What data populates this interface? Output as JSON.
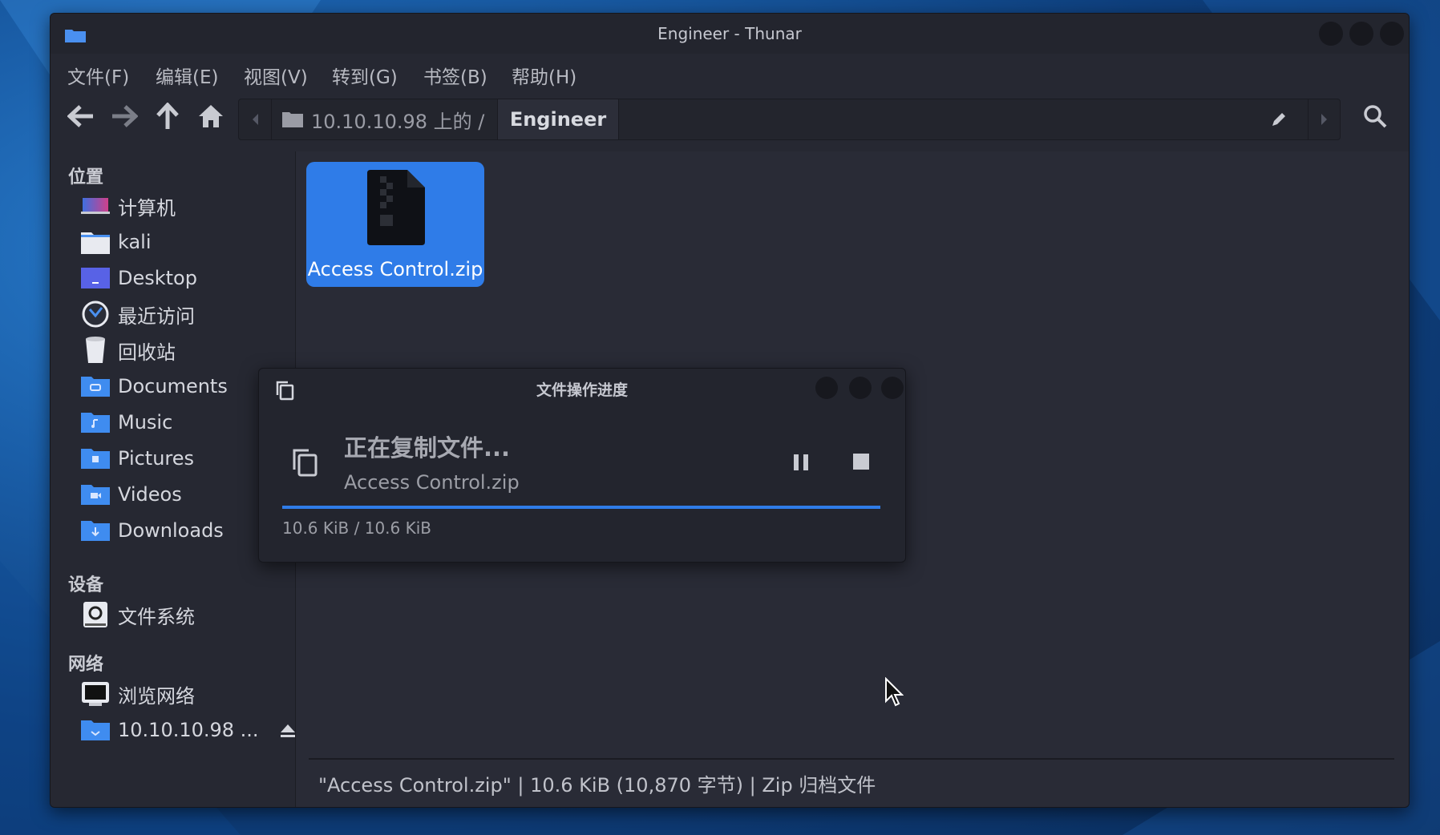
{
  "window": {
    "title": "Engineer - Thunar"
  },
  "menu": [
    {
      "label": "文件(F)"
    },
    {
      "label": "编辑(E)"
    },
    {
      "label": "视图(V)"
    },
    {
      "label": "转到(G)"
    },
    {
      "label": "书签(B)"
    },
    {
      "label": "帮助(H)"
    }
  ],
  "path": {
    "parent": "10.10.10.98 上的 /",
    "current": "Engineer"
  },
  "sidebar": {
    "places_title": "位置",
    "places": [
      {
        "label": "计算机",
        "icon": "computer-icon"
      },
      {
        "label": "kali",
        "icon": "home-folder-icon"
      },
      {
        "label": "Desktop",
        "icon": "desktop-folder-icon"
      },
      {
        "label": "最近访问",
        "icon": "recent-icon"
      },
      {
        "label": "回收站",
        "icon": "trash-icon"
      },
      {
        "label": "Documents",
        "icon": "documents-folder-icon"
      },
      {
        "label": "Music",
        "icon": "music-folder-icon"
      },
      {
        "label": "Pictures",
        "icon": "pictures-folder-icon"
      },
      {
        "label": "Videos",
        "icon": "videos-folder-icon"
      },
      {
        "label": "Downloads",
        "icon": "downloads-folder-icon"
      }
    ],
    "devices_title": "设备",
    "devices": [
      {
        "label": "文件系统",
        "icon": "drive-icon"
      }
    ],
    "network_title": "网络",
    "network": [
      {
        "label": "浏览网络",
        "icon": "network-icon"
      },
      {
        "label": "10.10.10.98 ...",
        "icon": "network-share-icon"
      }
    ]
  },
  "files": [
    {
      "name": "Access Control.zip",
      "selected": true
    }
  ],
  "statusbar": {
    "text": "\"Access Control.zip\" | 10.6 KiB (10,870 字节) | Zip 归档文件"
  },
  "dialog": {
    "title": "文件操作进度",
    "heading": "正在复制文件...",
    "file": "Access Control.zip",
    "sizes": "10.6 KiB / 10.6 KiB",
    "progress": 1.0
  },
  "colors": {
    "accent": "#2f7ce8",
    "window_bg": "#262832",
    "content_bg": "#292b36"
  }
}
